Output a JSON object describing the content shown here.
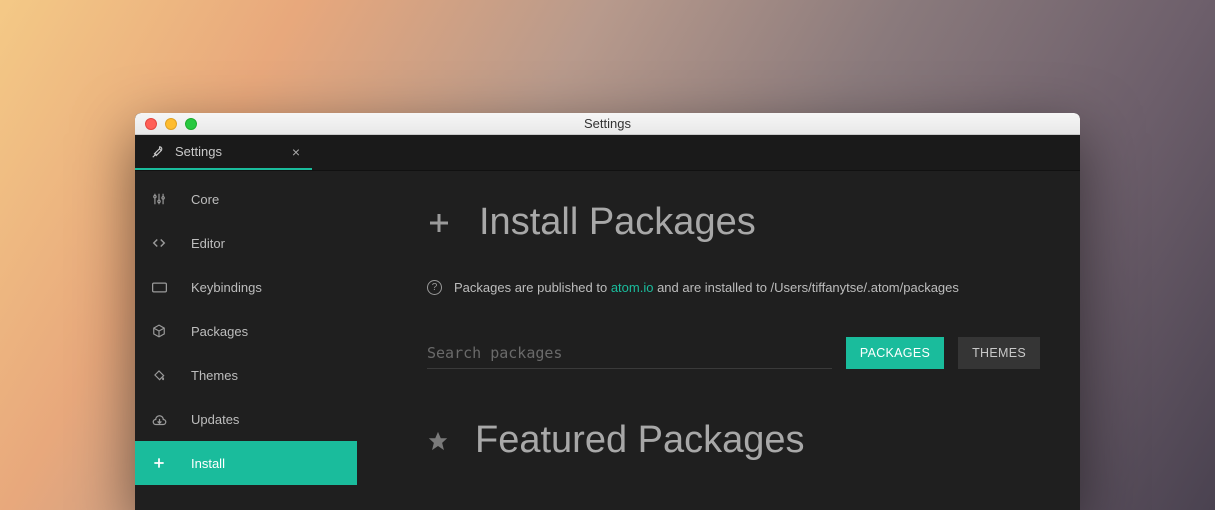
{
  "window": {
    "title": "Settings"
  },
  "tab": {
    "label": "Settings"
  },
  "sidebar": {
    "items": [
      {
        "label": "Core"
      },
      {
        "label": "Editor"
      },
      {
        "label": "Keybindings"
      },
      {
        "label": "Packages"
      },
      {
        "label": "Themes"
      },
      {
        "label": "Updates"
      },
      {
        "label": "Install"
      }
    ]
  },
  "main": {
    "title": "Install Packages",
    "info_pre": "Packages are published to ",
    "info_link": "atom.io",
    "info_post": " and are installed to /Users/tiffanytse/.atom/packages",
    "search_placeholder": "Search packages",
    "btn_packages": "PACKAGES",
    "btn_themes": "THEMES",
    "featured_title": "Featured Packages"
  },
  "colors": {
    "accent": "#1abc9c"
  }
}
